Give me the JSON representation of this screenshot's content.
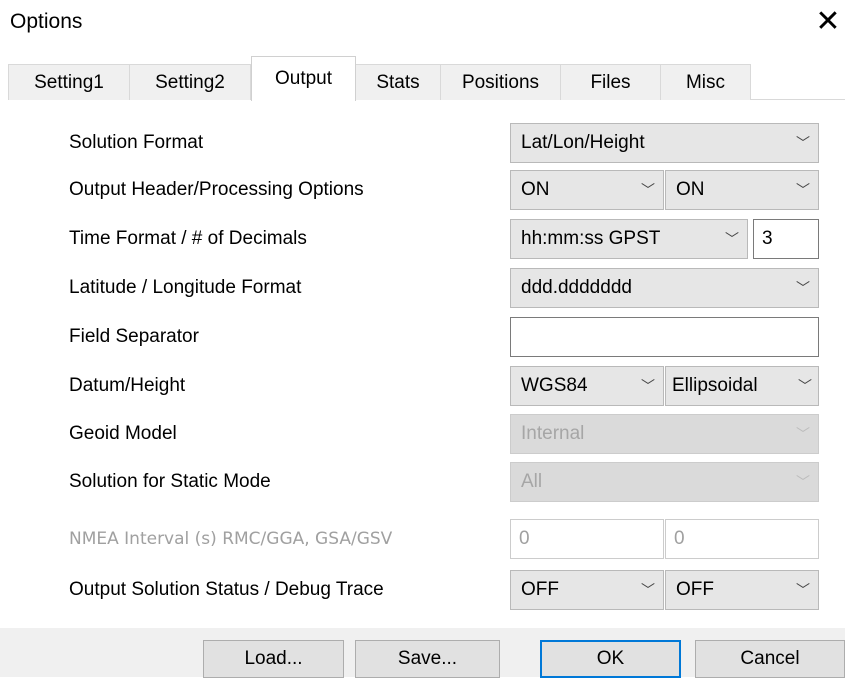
{
  "window": {
    "title": "Options"
  },
  "tabs": [
    {
      "label": "Setting1"
    },
    {
      "label": "Setting2"
    },
    {
      "label": "Output"
    },
    {
      "label": "Stats"
    },
    {
      "label": "Positions"
    },
    {
      "label": "Files"
    },
    {
      "label": "Misc"
    }
  ],
  "active_tab": "Output",
  "rows": {
    "solution_format": {
      "label": "Solution Format",
      "value": "Lat/Lon/Height"
    },
    "output_header": {
      "label": "Output Header/Processing Options",
      "value1": "ON",
      "value2": "ON"
    },
    "time_format": {
      "label": "Time Format / # of Decimals",
      "value": "hh:mm:ss GPST",
      "decimals": "3"
    },
    "latlon_format": {
      "label": "Latitude / Longitude Format",
      "value": "ddd.ddddddd"
    },
    "field_separator": {
      "label": "Field Separator",
      "value": ""
    },
    "datum_height": {
      "label": "Datum/Height",
      "value1": "WGS84",
      "value2": "Ellipsoidal"
    },
    "geoid_model": {
      "label": "Geoid Model",
      "value": "Internal"
    },
    "static_mode": {
      "label": "Solution for Static Mode",
      "value": "All"
    },
    "nmea_interval": {
      "label": "NMEA Interval (s) RMC/GGA, GSA/GSV",
      "value1": "0",
      "value2": "0"
    },
    "solution_status": {
      "label": "Output Solution Status / Debug Trace",
      "value1": "OFF",
      "value2": "OFF"
    }
  },
  "buttons": {
    "load": "Load...",
    "save": "Save...",
    "ok": "OK",
    "cancel": "Cancel"
  },
  "icons": {
    "close": "close-icon",
    "dropdown": "chevron-down-icon"
  },
  "colors": {
    "accent": "#0078d7",
    "disabled_text": "#a0a0a0"
  }
}
